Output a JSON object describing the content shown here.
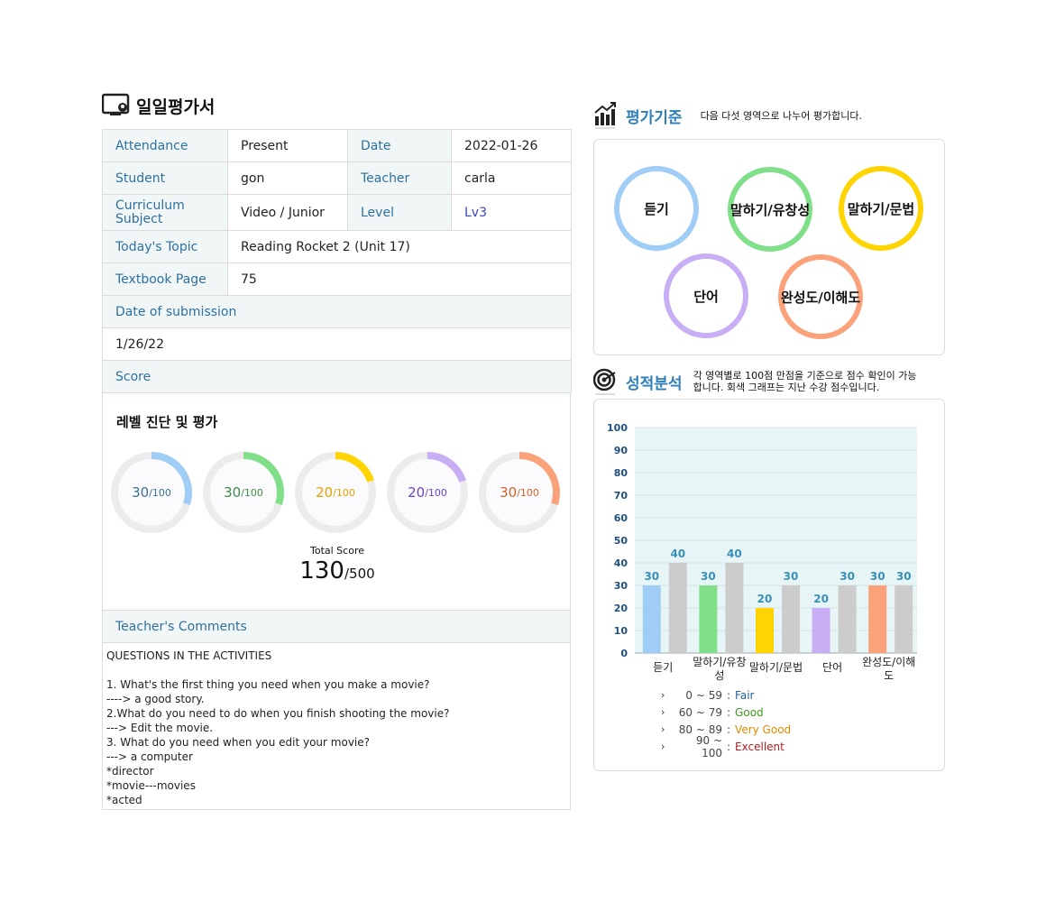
{
  "report": {
    "title": "일일평가서",
    "rows": {
      "attendance_label": "Attendance",
      "attendance_value": "Present",
      "date_label": "Date",
      "date_value": "2022-01-26",
      "student_label": "Student",
      "student_value": "gon",
      "teacher_label": "Teacher",
      "teacher_value": "carla",
      "curriculum_label": "Curriculum Subject",
      "curriculum_value": "Video / Junior",
      "level_label": "Level",
      "level_value": "Lv3",
      "topic_label": "Today's Topic",
      "topic_value": "Reading Rocket 2 (Unit 17)",
      "page_label": "Textbook Page",
      "page_value": "75",
      "submission_label": "Date of submission",
      "submission_value": "1/26/22",
      "score_label": "Score"
    },
    "score": {
      "heading": "레벨 진단 및 평가",
      "items": [
        {
          "value": "30",
          "max": "/100",
          "fraction": 0.3,
          "color": "#9fcdf6",
          "text_color": "#3c6f96"
        },
        {
          "value": "30",
          "max": "/100",
          "fraction": 0.3,
          "color": "#80e08a",
          "text_color": "#3f8a47"
        },
        {
          "value": "20",
          "max": "/100",
          "fraction": 0.2,
          "color": "#ffd400",
          "text_color": "#e3a200"
        },
        {
          "value": "20",
          "max": "/100",
          "fraction": 0.2,
          "color": "#c7aef5",
          "text_color": "#6a45bf"
        },
        {
          "value": "30",
          "max": "/100",
          "fraction": 0.3,
          "color": "#fba27a",
          "text_color": "#d3602c"
        }
      ],
      "total_caption": "Total Score",
      "total_value": "130",
      "total_max": "/500"
    },
    "comments": {
      "label": "Teacher's Comments",
      "text": "QUESTIONS IN THE ACTIVITIES\n\n1. What's the first thing you need when you make a movie?\n----> a good story.\n2.What do you need to do when you finish shooting the movie?\n---> Edit the movie.\n3. What do you need when you edit your movie?\n---> a computer\n*director\n*movie---movies\n*acted"
    }
  },
  "criteria": {
    "title": "평가기준",
    "desc": "다음 다섯 영역으로 나누어 평가합니다.",
    "rings": [
      {
        "label": "듣기",
        "color": "#9fcdf6"
      },
      {
        "label": "말하기/유창성",
        "color": "#80e08a"
      },
      {
        "label": "말하기/문법",
        "color": "#ffd400"
      },
      {
        "label": "단어",
        "color": "#c7aef5"
      },
      {
        "label": "완성도/이해도",
        "color": "#fba27a"
      }
    ]
  },
  "analysis": {
    "title": "성적분석",
    "desc_line1": "각 영역별로 100점 만점을 기준으로 점수 확인이 가능",
    "desc_line2": "합니다. 회색 그래프는 지난 수강 점수입니다.",
    "legend": [
      {
        "range": "0 ~  59",
        "label": "Fair",
        "color": "#1f5f9f"
      },
      {
        "range": "60 ~  79",
        "label": "Good",
        "color": "#3c9a1a"
      },
      {
        "range": "80 ~  89",
        "label": "Very Good",
        "color": "#e38a00"
      },
      {
        "range": "90 ~ 100",
        "label": "Excellent",
        "color": "#b01c1c"
      }
    ]
  },
  "chart_data": {
    "type": "bar",
    "categories": [
      "듣기",
      "말하기/유창성",
      "말하기/문법",
      "단어",
      "완성도/이해도"
    ],
    "series": [
      {
        "values": [
          30,
          30,
          20,
          20,
          30
        ],
        "colors": [
          "#9fcdf6",
          "#80e08a",
          "#ffd400",
          "#c7aef5",
          "#fba27a"
        ]
      },
      {
        "values": [
          40,
          40,
          30,
          30,
          30
        ],
        "color": "#cccccc"
      }
    ],
    "ylim": [
      0,
      100
    ],
    "yticks": [
      0,
      10,
      20,
      30,
      40,
      50,
      60,
      70,
      80,
      90,
      100
    ],
    "grid": true
  }
}
